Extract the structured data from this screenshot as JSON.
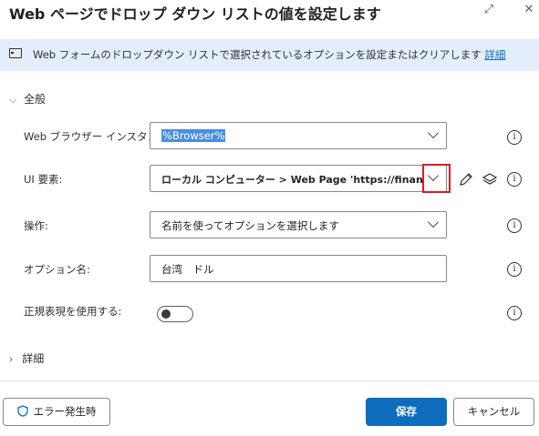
{
  "dialog": {
    "title": "Web ページでドロップ ダウン リストの値を設定します",
    "expand_glyph": "⤢",
    "close_glyph": "✕"
  },
  "info_bar": {
    "text": "Web フォームのドロップダウン リストで選択されているオプションを設定またはクリアします",
    "link": "詳細",
    "icon": "monitor-icon"
  },
  "sections": {
    "general": "全般",
    "advanced": "詳細"
  },
  "fields": {
    "browser": {
      "label": "Web ブラウザー インスタンス:",
      "value": "%Browser%"
    },
    "ui_element": {
      "label": "UI 要素:",
      "value": "ローカル コンピューター > Web Page 'https://finance.yahoo"
    },
    "operation": {
      "label": "操作:",
      "value": "名前を使ってオプションを選択します"
    },
    "option_name": {
      "label": "オプション名:",
      "value": "台湾　ドル"
    },
    "regex": {
      "label": "正規表現を使用する:",
      "value": false
    }
  },
  "help_glyph": "i",
  "footer": {
    "error_button": "エラー発生時",
    "save_button": "保存",
    "cancel_button": "キャンセル"
  },
  "colors": {
    "accent": "#0f6cbd",
    "info_bar_bg": "#e3eefa",
    "highlight_box": "#e01b24"
  }
}
